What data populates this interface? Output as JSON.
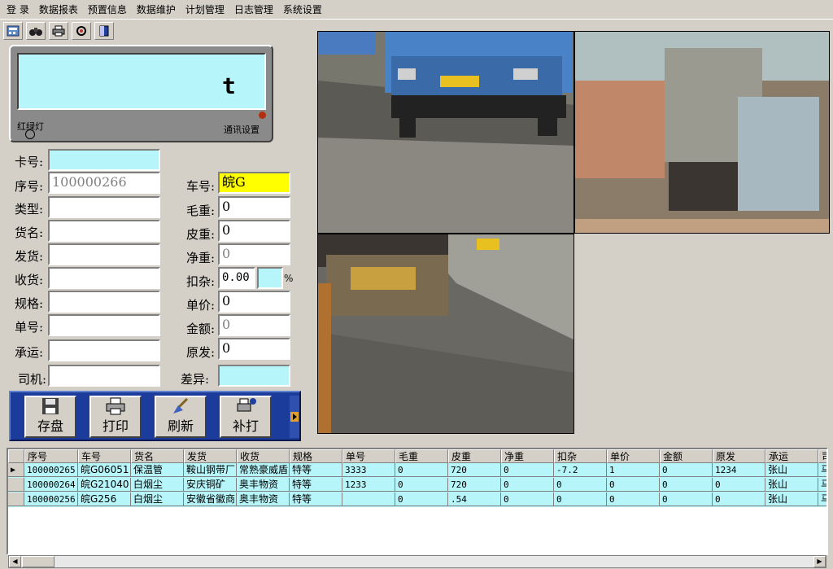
{
  "menu": [
    "登 录",
    "数据报表",
    "预置信息",
    "数据维护",
    "计划管理",
    "日志管理",
    "系统设置"
  ],
  "toolbar": {
    "icons": [
      "calculator-icon",
      "binoculars-icon",
      "printer-icon",
      "settings-icon",
      "exit-icon"
    ]
  },
  "display": {
    "unit": "t",
    "light_label": "红绿灯",
    "comm_label": "通讯设置"
  },
  "form": {
    "card_label": "卡号:",
    "card_value": "",
    "serial_label": "序号:",
    "serial_value": "100000266",
    "type_label": "类型:",
    "type_value": "",
    "goods_label": "货名:",
    "goods_value": "",
    "sender_label": "发货:",
    "sender_value": "",
    "receiver_label": "收货:",
    "receiver_value": "",
    "spec_label": "规格:",
    "spec_value": "",
    "order_label": "单号:",
    "order_value": "",
    "carrier_label": "承运:",
    "carrier_value": "",
    "driver_label": "司机:",
    "driver_value": "",
    "plate_label": "车号:",
    "plate_value": "皖G",
    "gross_label": "毛重:",
    "gross_value": "0",
    "tare_label": "皮重:",
    "tare_value": "0",
    "net_label": "净重:",
    "net_value": "0",
    "deduct_label": "扣杂:",
    "deduct_value": "0.00",
    "deduct_pct_value": "",
    "deduct_unit": "%",
    "price_label": "单价:",
    "price_value": "0",
    "amount_label": "金额:",
    "amount_value": "0",
    "origin_label": "原发:",
    "origin_value": "0",
    "diff_label": "差异:",
    "diff_value": ""
  },
  "buttons": {
    "save": "存盘",
    "print": "打印",
    "refresh": "刷新",
    "reprint": "补打"
  },
  "grid": {
    "columns": [
      "序号",
      "车号",
      "货名",
      "发货",
      "收货",
      "规格",
      "单号",
      "毛重",
      "皮重",
      "净重",
      "扣杂",
      "单价",
      "金额",
      "原发",
      "承运",
      "司"
    ],
    "rows": [
      [
        "100000265",
        "皖G06051",
        "保温管",
        "鞍山钢带厂",
        "常熟豪威盾",
        "特等",
        "3333",
        "0",
        "720",
        "0",
        "-7.2",
        "1",
        "0",
        "1234",
        "张山",
        "马"
      ],
      [
        "100000264",
        "皖G21040",
        "白烟尘",
        "安庆铜矿",
        "奥丰物资",
        "特等",
        "1233",
        "0",
        "720",
        "0",
        "0",
        "0",
        "0",
        "0",
        "张山",
        "马"
      ],
      [
        "100000256",
        "皖G256",
        "白烟尘",
        "安徽省徽商",
        "奥丰物资",
        "特等",
        "",
        "0",
        ".54",
        "0",
        "0",
        "0",
        "0",
        "0",
        "张山",
        "马"
      ]
    ]
  }
}
